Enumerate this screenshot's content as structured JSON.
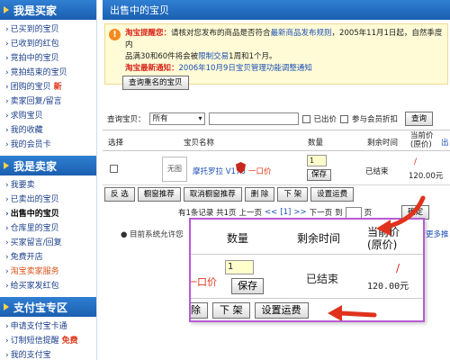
{
  "sidebar": {
    "sections": [
      {
        "title": "我是买家",
        "items": [
          {
            "label": "已买到的宝贝"
          },
          {
            "label": "已收到的红包"
          },
          {
            "label": "竞拍中的宝贝"
          },
          {
            "label": "竞拍结束的宝贝"
          },
          {
            "label": "团购的宝贝",
            "badge": "新"
          },
          {
            "label": "卖家回复/留言"
          },
          {
            "label": "求购宝贝"
          },
          {
            "label": "我的收藏"
          },
          {
            "label": "我的会员卡"
          }
        ]
      },
      {
        "title": "我是卖家",
        "items": [
          {
            "label": "我要卖"
          },
          {
            "label": "已卖出的宝贝"
          },
          {
            "label": "出售中的宝贝",
            "active": true
          },
          {
            "label": "仓库里的宝贝"
          },
          {
            "label": "买家留言/回复"
          },
          {
            "label": "免费开店"
          },
          {
            "label": "淘宝卖家服务",
            "highlight": true
          },
          {
            "label": "给买家发红包"
          }
        ]
      },
      {
        "title": "支付宝专区",
        "items": [
          {
            "label": "申请支付宝卡通"
          },
          {
            "label": "订制短信提醒",
            "badge": "免费"
          },
          {
            "label": "我的支付宝"
          }
        ]
      }
    ]
  },
  "main": {
    "title": "出售中的宝贝",
    "notice": {
      "label1": "淘宝提醒您：",
      "text1": "请核对您发布的商品是否符合",
      "link1": "最新商品发布规则",
      "text2": "，2005年11月1日起，自然季度内",
      "text3": "品满30和60件将会被",
      "link2": "限制交易",
      "text4": "1周和1个月。",
      "label2": "淘宝最新通知：",
      "link3": "2006年10月9日宝贝管理功能调整通知"
    },
    "query_frame_button": "查询重名的宝贝",
    "search": {
      "label": "查询宝贝：",
      "category_value": "所有",
      "query_button": "查询",
      "option1": "已出价",
      "option2": "参与会员折扣"
    },
    "table": {
      "headers": {
        "select": "选择",
        "name": "宝贝名称",
        "qty": "数量",
        "remaining": "剩余时间",
        "price": "当前价(原价)",
        "out": "出"
      },
      "row": {
        "thumb": "无图",
        "name": "摩托罗拉 V176",
        "type": "一口价",
        "qty": "1",
        "save": "保存",
        "status": "已结束",
        "price": "120.00元"
      }
    },
    "actions": [
      "反 选",
      "橱窗推荐",
      "取消橱窗推荐",
      "删 除",
      "下 架",
      "设置运费"
    ],
    "pager": {
      "summary": "有1条记录 共1页",
      "prev": "上一页",
      "current": "[1]",
      "next": "下一页",
      "goto": "到",
      "page": "页",
      "go_button": "确定"
    },
    "foot_note": "目前系统允许您",
    "foot_note_tail": "查看更多推荐"
  },
  "zoom": {
    "headers": {
      "qty": "数量",
      "remaining": "剩余时间",
      "price": "当前价",
      "price_orig": "(原价)"
    },
    "type": "一口价",
    "qty": "1",
    "save": "保存",
    "status": "已结束",
    "price": "120.00元",
    "actions": [
      "除",
      "下 架",
      "设置运费"
    ]
  },
  "colors": {
    "header_blue": "#2f7fd3",
    "accent_red": "#d9261c",
    "link_blue": "#1a4fb5",
    "popup_border": "#b75bd6",
    "notice_bg": "#fffbd6"
  }
}
